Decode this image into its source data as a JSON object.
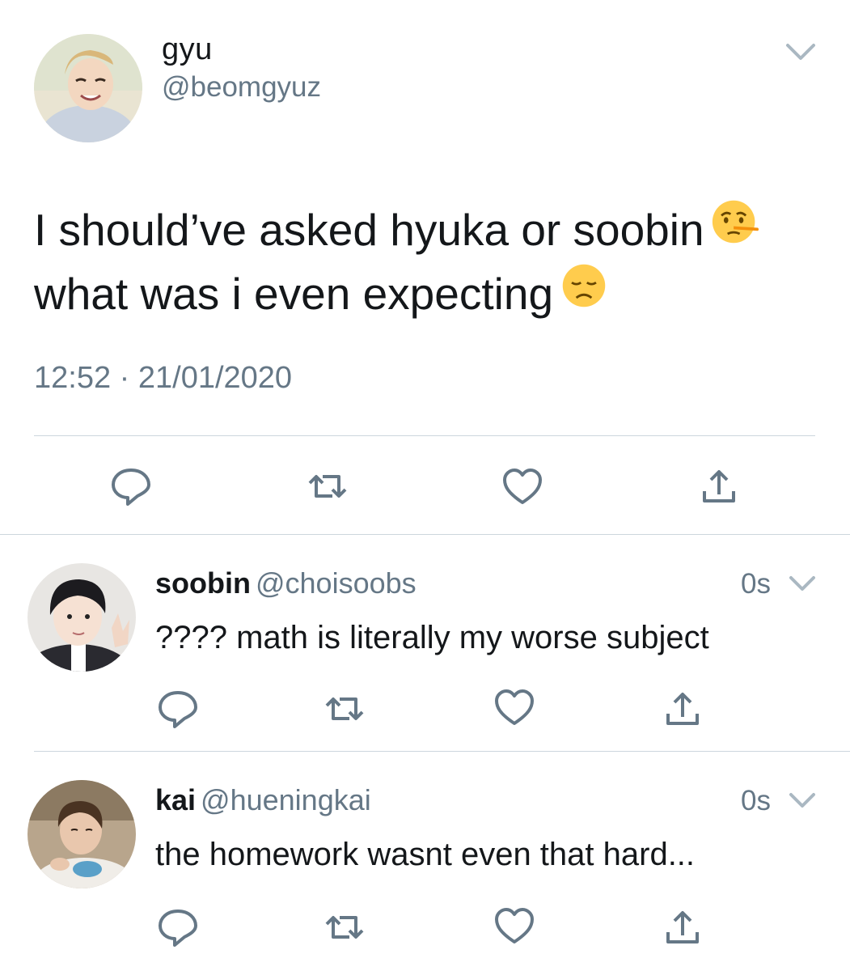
{
  "main_tweet": {
    "display_name": "gyu",
    "handle": "@beomgyuz",
    "text_line1": "I should’ve asked hyuka or soobin",
    "text_line2": "what was i even expecting",
    "emoji1": "lying-face-emoji",
    "emoji2": "disappointed-face-emoji",
    "time": "12:52",
    "separator": "·",
    "date": "21/01/2020",
    "avatar": "profile-photo"
  },
  "replies": [
    {
      "display_name": "soobin",
      "handle": "@choisoobs",
      "time": "0s",
      "text": "???? math is literally my worse subject",
      "avatar": "profile-photo"
    },
    {
      "display_name": "kai",
      "handle": "@hueningkai",
      "time": "0s",
      "text": "the homework wasnt even that hard...",
      "avatar": "profile-photo"
    }
  ],
  "actions": [
    "reply-icon",
    "retweet-icon",
    "like-icon",
    "share-icon"
  ],
  "colors": {
    "text": "#14171a",
    "secondary": "#657786",
    "icon": "#657786",
    "divider": "#ccd6dd",
    "background": "#ffffff"
  }
}
